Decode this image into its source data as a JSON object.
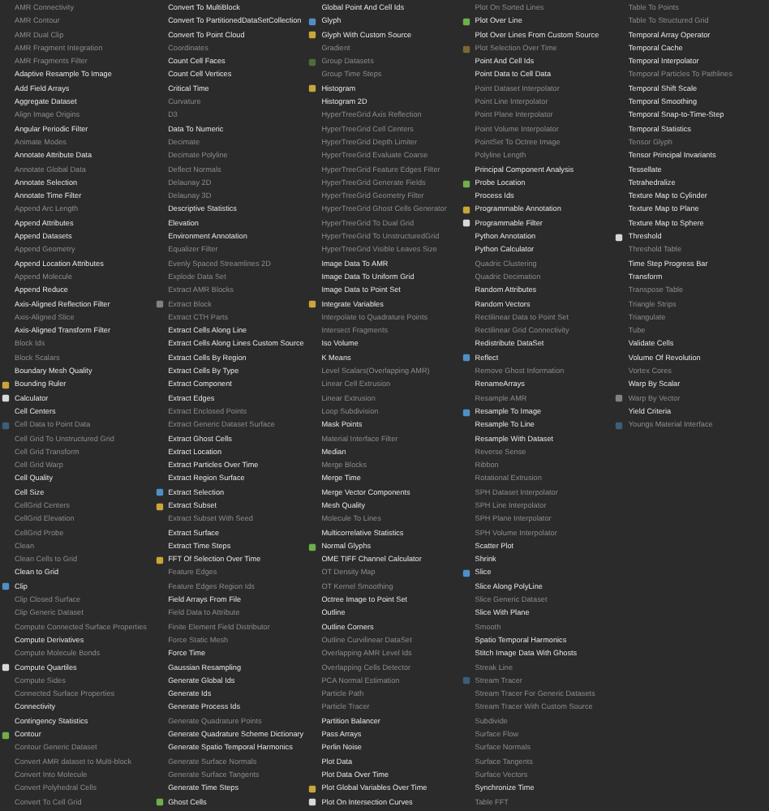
{
  "menu": {
    "columns": [
      {
        "items": [
          {
            "label": "AMR Connectivity",
            "disabled": true,
            "kind": "plain"
          },
          {
            "label": "AMR Contour",
            "disabled": true,
            "kind": "plain"
          },
          {
            "label": "AMR Dual Clip",
            "disabled": true,
            "kind": "plain"
          },
          {
            "label": "AMR Fragment Integration",
            "disabled": true,
            "kind": "plain"
          },
          {
            "label": "AMR Fragments Filter",
            "disabled": true,
            "kind": "plain"
          },
          {
            "label": "Adaptive Resample To Image",
            "disabled": false,
            "kind": "plain"
          },
          {
            "label": "Add Field Arrays",
            "disabled": false,
            "kind": "plain"
          },
          {
            "label": "Aggregate Dataset",
            "disabled": false,
            "kind": "plain"
          },
          {
            "label": "Align Image Origins",
            "disabled": true,
            "kind": "plain"
          },
          {
            "label": "Angular Periodic Filter",
            "disabled": false,
            "kind": "plain"
          },
          {
            "label": "Animate Modes",
            "disabled": true,
            "kind": "plain"
          },
          {
            "label": "Annotate Attribute Data",
            "disabled": false,
            "kind": "plain"
          },
          {
            "label": "Annotate Global Data",
            "disabled": true,
            "kind": "plain"
          },
          {
            "label": "Annotate Selection",
            "disabled": false,
            "kind": "plain"
          },
          {
            "label": "Annotate Time Filter",
            "disabled": false,
            "kind": "plain"
          },
          {
            "label": "Append Arc Length",
            "disabled": true,
            "kind": "plain"
          },
          {
            "label": "Append Attributes",
            "disabled": false,
            "kind": "plain"
          },
          {
            "label": "Append Datasets",
            "disabled": false,
            "kind": "plain"
          },
          {
            "label": "Append Geometry",
            "disabled": true,
            "kind": "plain"
          },
          {
            "label": "Append Location Attributes",
            "disabled": false,
            "kind": "plain"
          },
          {
            "label": "Append Molecule",
            "disabled": true,
            "kind": "plain"
          },
          {
            "label": "Append Reduce",
            "disabled": false,
            "kind": "plain"
          },
          {
            "label": "Axis-Aligned Reflection Filter",
            "disabled": false,
            "kind": "plain"
          },
          {
            "label": "Axis-Aligned Slice",
            "disabled": true,
            "kind": "plain"
          },
          {
            "label": "Axis-Aligned Transform Filter",
            "disabled": false,
            "kind": "plain"
          },
          {
            "label": "Block Ids",
            "disabled": true,
            "kind": "plain"
          },
          {
            "label": "Block Scalars",
            "disabled": true,
            "kind": "plain"
          },
          {
            "label": "Boundary Mesh Quality",
            "disabled": false,
            "kind": "plain"
          },
          {
            "label": "Bounding Ruler",
            "disabled": false,
            "kind": "icon"
          },
          {
            "label": "Calculator",
            "disabled": false,
            "kind": "icon"
          },
          {
            "label": "Cell Centers",
            "disabled": false,
            "kind": "plain"
          },
          {
            "label": "Cell Data to Point Data",
            "disabled": true,
            "kind": "icon"
          },
          {
            "label": "Cell Grid To Unstructured Grid",
            "disabled": true,
            "kind": "plain"
          },
          {
            "label": "Cell Grid Transform",
            "disabled": true,
            "kind": "plain"
          },
          {
            "label": "Cell Grid Warp",
            "disabled": true,
            "kind": "plain"
          },
          {
            "label": "Cell Quality",
            "disabled": false,
            "kind": "plain"
          },
          {
            "label": "Cell Size",
            "disabled": false,
            "kind": "plain"
          },
          {
            "label": "CellGrid Centers",
            "disabled": true,
            "kind": "plain"
          },
          {
            "label": "CellGrid Elevation",
            "disabled": true,
            "kind": "plain"
          },
          {
            "label": "CellGrid Probe",
            "disabled": true,
            "kind": "plain"
          },
          {
            "label": "Clean",
            "disabled": true,
            "kind": "plain"
          },
          {
            "label": "Clean Cells to Grid",
            "disabled": true,
            "kind": "plain"
          },
          {
            "label": "Clean to Grid",
            "disabled": false,
            "kind": "plain"
          },
          {
            "label": "Clip",
            "disabled": false,
            "kind": "icon"
          },
          {
            "label": "Clip Closed Surface",
            "disabled": true,
            "kind": "plain"
          },
          {
            "label": "Clip Generic Dataset",
            "disabled": true,
            "kind": "plain"
          },
          {
            "label": "Compute Connected Surface Properties",
            "disabled": true,
            "kind": "plain"
          },
          {
            "label": "Compute Derivatives",
            "disabled": false,
            "kind": "plain"
          },
          {
            "label": "Compute Molecule Bonds",
            "disabled": true,
            "kind": "plain"
          },
          {
            "label": "Compute Quartiles",
            "disabled": false,
            "kind": "icon"
          },
          {
            "label": "Compute Sides",
            "disabled": true,
            "kind": "plain"
          },
          {
            "label": "Connected Surface Properties",
            "disabled": true,
            "kind": "plain"
          },
          {
            "label": "Connectivity",
            "disabled": false,
            "kind": "plain"
          },
          {
            "label": "Contingency Statistics",
            "disabled": false,
            "kind": "plain"
          },
          {
            "label": "Contour",
            "disabled": false,
            "kind": "icon"
          },
          {
            "label": "Contour Generic Dataset",
            "disabled": true,
            "kind": "plain"
          },
          {
            "label": "Convert AMR dataset to Multi-block",
            "disabled": true,
            "kind": "plain"
          },
          {
            "label": "Convert Into Molecule",
            "disabled": true,
            "kind": "plain"
          },
          {
            "label": "Convert Polyhedral Cells",
            "disabled": true,
            "kind": "plain"
          },
          {
            "label": "Convert To Cell Grid",
            "disabled": true,
            "kind": "plain"
          }
        ]
      },
      {
        "items": [
          {
            "label": "Convert To MultiBlock",
            "disabled": false,
            "kind": "plain"
          },
          {
            "label": "Convert To PartitionedDataSetCollection",
            "disabled": false,
            "kind": "plain"
          },
          {
            "label": "Convert To Point Cloud",
            "disabled": false,
            "kind": "plain"
          },
          {
            "label": "Coordinates",
            "disabled": true,
            "kind": "plain"
          },
          {
            "label": "Count Cell Faces",
            "disabled": false,
            "kind": "plain"
          },
          {
            "label": "Count Cell Vertices",
            "disabled": false,
            "kind": "plain"
          },
          {
            "label": "Critical Time",
            "disabled": false,
            "kind": "plain"
          },
          {
            "label": "Curvature",
            "disabled": true,
            "kind": "plain"
          },
          {
            "label": "D3",
            "disabled": true,
            "kind": "plain"
          },
          {
            "label": "Data To Numeric",
            "disabled": false,
            "kind": "plain"
          },
          {
            "label": "Decimate",
            "disabled": true,
            "kind": "plain"
          },
          {
            "label": "Decimate Polyline",
            "disabled": true,
            "kind": "plain"
          },
          {
            "label": "Deflect Normals",
            "disabled": true,
            "kind": "plain"
          },
          {
            "label": "Delaunay 2D",
            "disabled": true,
            "kind": "plain"
          },
          {
            "label": "Delaunay 3D",
            "disabled": true,
            "kind": "plain"
          },
          {
            "label": "Descriptive Statistics",
            "disabled": false,
            "kind": "plain"
          },
          {
            "label": "Elevation",
            "disabled": false,
            "kind": "plain"
          },
          {
            "label": "Environment Annotation",
            "disabled": false,
            "kind": "plain"
          },
          {
            "label": "Equalizer Filter",
            "disabled": true,
            "kind": "plain"
          },
          {
            "label": "Evenly Spaced Streamlines 2D",
            "disabled": true,
            "kind": "plain"
          },
          {
            "label": "Explode Data Set",
            "disabled": true,
            "kind": "plain"
          },
          {
            "label": "Extract AMR Blocks",
            "disabled": true,
            "kind": "plain"
          },
          {
            "label": "Extract Block",
            "disabled": true,
            "kind": "icon"
          },
          {
            "label": "Extract CTH Parts",
            "disabled": true,
            "kind": "plain"
          },
          {
            "label": "Extract Cells Along Line",
            "disabled": false,
            "kind": "plain"
          },
          {
            "label": "Extract Cells Along Lines Custom Source",
            "disabled": false,
            "kind": "plain"
          },
          {
            "label": "Extract Cells By Region",
            "disabled": false,
            "kind": "plain"
          },
          {
            "label": "Extract Cells By Type",
            "disabled": false,
            "kind": "plain"
          },
          {
            "label": "Extract Component",
            "disabled": false,
            "kind": "plain"
          },
          {
            "label": "Extract Edges",
            "disabled": false,
            "kind": "plain"
          },
          {
            "label": "Extract Enclosed Points",
            "disabled": true,
            "kind": "plain"
          },
          {
            "label": "Extract Generic Dataset Surface",
            "disabled": true,
            "kind": "plain"
          },
          {
            "label": "Extract Ghost Cells",
            "disabled": false,
            "kind": "plain"
          },
          {
            "label": "Extract Location",
            "disabled": false,
            "kind": "plain"
          },
          {
            "label": "Extract Particles Over Time",
            "disabled": false,
            "kind": "plain"
          },
          {
            "label": "Extract Region Surface",
            "disabled": false,
            "kind": "plain"
          },
          {
            "label": "Extract Selection",
            "disabled": false,
            "kind": "icon"
          },
          {
            "label": "Extract Subset",
            "disabled": false,
            "kind": "icon"
          },
          {
            "label": "Extract Subset With Seed",
            "disabled": true,
            "kind": "plain"
          },
          {
            "label": "Extract Surface",
            "disabled": false,
            "kind": "plain"
          },
          {
            "label": "Extract Time Steps",
            "disabled": false,
            "kind": "plain"
          },
          {
            "label": "FFT Of Selection Over Time",
            "disabled": false,
            "kind": "icon"
          },
          {
            "label": "Feature Edges",
            "disabled": true,
            "kind": "plain"
          },
          {
            "label": "Feature Edges Region Ids",
            "disabled": true,
            "kind": "plain"
          },
          {
            "label": "Field Arrays From File",
            "disabled": false,
            "kind": "plain"
          },
          {
            "label": "Field Data to Attribute",
            "disabled": true,
            "kind": "plain"
          },
          {
            "label": "Finite Element Field Distributor",
            "disabled": true,
            "kind": "plain"
          },
          {
            "label": "Force Static Mesh",
            "disabled": true,
            "kind": "plain"
          },
          {
            "label": "Force Time",
            "disabled": false,
            "kind": "plain"
          },
          {
            "label": "Gaussian Resampling",
            "disabled": false,
            "kind": "plain"
          },
          {
            "label": "Generate Global Ids",
            "disabled": false,
            "kind": "plain"
          },
          {
            "label": "Generate Ids",
            "disabled": false,
            "kind": "plain"
          },
          {
            "label": "Generate Process Ids",
            "disabled": false,
            "kind": "plain"
          },
          {
            "label": "Generate Quadrature Points",
            "disabled": true,
            "kind": "plain"
          },
          {
            "label": "Generate Quadrature Scheme Dictionary",
            "disabled": false,
            "kind": "plain"
          },
          {
            "label": "Generate Spatio Temporal Harmonics",
            "disabled": false,
            "kind": "plain"
          },
          {
            "label": "Generate Surface Normals",
            "disabled": true,
            "kind": "plain"
          },
          {
            "label": "Generate Surface Tangents",
            "disabled": true,
            "kind": "plain"
          },
          {
            "label": "Generate Time Steps",
            "disabled": false,
            "kind": "plain"
          },
          {
            "label": "Ghost Cells",
            "disabled": false,
            "kind": "icon"
          }
        ]
      },
      {
        "items": [
          {
            "label": "Global Point And Cell Ids",
            "disabled": false,
            "kind": "plain"
          },
          {
            "label": "Glyph",
            "disabled": false,
            "kind": "icon"
          },
          {
            "label": "Glyph With Custom Source",
            "disabled": false,
            "kind": "icon"
          },
          {
            "label": "Gradient",
            "disabled": true,
            "kind": "plain"
          },
          {
            "label": "Group Datasets",
            "disabled": true,
            "kind": "icon"
          },
          {
            "label": "Group Time Steps",
            "disabled": true,
            "kind": "plain"
          },
          {
            "label": "Histogram",
            "disabled": false,
            "kind": "icon"
          },
          {
            "label": "Histogram 2D",
            "disabled": false,
            "kind": "plain"
          },
          {
            "label": "HyperTreeGrid Axis Reflection",
            "disabled": true,
            "kind": "plain"
          },
          {
            "label": "HyperTreeGrid Cell Centers",
            "disabled": true,
            "kind": "plain"
          },
          {
            "label": "HyperTreeGrid Depth Limiter",
            "disabled": true,
            "kind": "plain"
          },
          {
            "label": "HyperTreeGrid Evaluate Coarse",
            "disabled": true,
            "kind": "plain"
          },
          {
            "label": "HyperTreeGrid Feature Edges Filter",
            "disabled": true,
            "kind": "plain"
          },
          {
            "label": "HyperTreeGrid Generate Fields",
            "disabled": true,
            "kind": "plain"
          },
          {
            "label": "HyperTreeGrid Geometry Filter",
            "disabled": true,
            "kind": "plain"
          },
          {
            "label": "HyperTreeGrid Ghost Cells Generator",
            "disabled": true,
            "kind": "plain"
          },
          {
            "label": "HyperTreeGrid To Dual Grid",
            "disabled": true,
            "kind": "plain"
          },
          {
            "label": "HyperTreeGrid To UnstructuredGrid",
            "disabled": true,
            "kind": "plain"
          },
          {
            "label": "HyperTreeGrid Visible Leaves Size",
            "disabled": true,
            "kind": "plain"
          },
          {
            "label": "Image Data To AMR",
            "disabled": false,
            "kind": "plain"
          },
          {
            "label": "Image Data To Uniform Grid",
            "disabled": false,
            "kind": "plain"
          },
          {
            "label": "Image Data to Point Set",
            "disabled": false,
            "kind": "plain"
          },
          {
            "label": "Integrate Variables",
            "disabled": false,
            "kind": "icon"
          },
          {
            "label": "Interpolate to Quadrature Points",
            "disabled": true,
            "kind": "plain"
          },
          {
            "label": "Intersect Fragments",
            "disabled": true,
            "kind": "plain"
          },
          {
            "label": "Iso Volume",
            "disabled": false,
            "kind": "plain"
          },
          {
            "label": "K Means",
            "disabled": false,
            "kind": "plain"
          },
          {
            "label": "Level Scalars(Overlapping AMR)",
            "disabled": true,
            "kind": "plain"
          },
          {
            "label": "Linear Cell Extrusion",
            "disabled": true,
            "kind": "plain"
          },
          {
            "label": "Linear Extrusion",
            "disabled": true,
            "kind": "plain"
          },
          {
            "label": "Loop Subdivision",
            "disabled": true,
            "kind": "plain"
          },
          {
            "label": "Mask Points",
            "disabled": false,
            "kind": "plain"
          },
          {
            "label": "Material Interface Filter",
            "disabled": true,
            "kind": "plain"
          },
          {
            "label": "Median",
            "disabled": false,
            "kind": "plain"
          },
          {
            "label": "Merge Blocks",
            "disabled": true,
            "kind": "plain"
          },
          {
            "label": "Merge Time",
            "disabled": false,
            "kind": "plain"
          },
          {
            "label": "Merge Vector Components",
            "disabled": false,
            "kind": "plain"
          },
          {
            "label": "Mesh Quality",
            "disabled": false,
            "kind": "plain"
          },
          {
            "label": "Molecule To Lines",
            "disabled": true,
            "kind": "plain"
          },
          {
            "label": "Multicorrelative Statistics",
            "disabled": false,
            "kind": "plain"
          },
          {
            "label": "Normal Glyphs",
            "disabled": false,
            "kind": "icon"
          },
          {
            "label": "OME TIFF Channel Calculator",
            "disabled": false,
            "kind": "plain"
          },
          {
            "label": "OT Density Map",
            "disabled": true,
            "kind": "plain"
          },
          {
            "label": "OT Kernel Smoothing",
            "disabled": true,
            "kind": "plain"
          },
          {
            "label": "Octree Image to Point Set",
            "disabled": false,
            "kind": "plain"
          },
          {
            "label": "Outline",
            "disabled": false,
            "kind": "plain"
          },
          {
            "label": "Outline Corners",
            "disabled": false,
            "kind": "plain"
          },
          {
            "label": "Outline Curvilinear DataSet",
            "disabled": true,
            "kind": "plain"
          },
          {
            "label": "Overlapping AMR Level Ids",
            "disabled": true,
            "kind": "plain"
          },
          {
            "label": "Overlapping Cells Detector",
            "disabled": true,
            "kind": "plain"
          },
          {
            "label": "PCA Normal Estimation",
            "disabled": true,
            "kind": "plain"
          },
          {
            "label": "Particle Path",
            "disabled": true,
            "kind": "plain"
          },
          {
            "label": "Particle Tracer",
            "disabled": true,
            "kind": "plain"
          },
          {
            "label": "Partition Balancer",
            "disabled": false,
            "kind": "plain"
          },
          {
            "label": "Pass Arrays",
            "disabled": false,
            "kind": "plain"
          },
          {
            "label": "Perlin Noise",
            "disabled": false,
            "kind": "plain"
          },
          {
            "label": "Plot Data",
            "disabled": false,
            "kind": "plain"
          },
          {
            "label": "Plot Data Over Time",
            "disabled": false,
            "kind": "plain"
          },
          {
            "label": "Plot Global Variables Over Time",
            "disabled": false,
            "kind": "icon"
          },
          {
            "label": "Plot On Intersection Curves",
            "disabled": false,
            "kind": "icon"
          }
        ]
      },
      {
        "items": [
          {
            "label": "Plot On Sorted Lines",
            "disabled": true,
            "kind": "plain"
          },
          {
            "label": "Plot Over Line",
            "disabled": false,
            "kind": "icon"
          },
          {
            "label": "Plot Over Lines From Custom Source",
            "disabled": false,
            "kind": "plain"
          },
          {
            "label": "Plot Selection Over Time",
            "disabled": true,
            "kind": "icon"
          },
          {
            "label": "Point And Cell Ids",
            "disabled": false,
            "kind": "plain"
          },
          {
            "label": "Point Data to Cell Data",
            "disabled": false,
            "kind": "plain"
          },
          {
            "label": "Point Dataset Interpolator",
            "disabled": true,
            "kind": "plain"
          },
          {
            "label": "Point Line Interpolator",
            "disabled": true,
            "kind": "plain"
          },
          {
            "label": "Point Plane Interpolator",
            "disabled": true,
            "kind": "plain"
          },
          {
            "label": "Point Volume Interpolator",
            "disabled": true,
            "kind": "plain"
          },
          {
            "label": "PointSet To Octree Image",
            "disabled": true,
            "kind": "plain"
          },
          {
            "label": "Polyline Length",
            "disabled": true,
            "kind": "plain"
          },
          {
            "label": "Principal Component Analysis",
            "disabled": false,
            "kind": "plain"
          },
          {
            "label": "Probe Location",
            "disabled": false,
            "kind": "icon"
          },
          {
            "label": "Process Ids",
            "disabled": false,
            "kind": "plain"
          },
          {
            "label": "Programmable Annotation",
            "disabled": false,
            "kind": "icon"
          },
          {
            "label": "Programmable Filter",
            "disabled": false,
            "kind": "icon"
          },
          {
            "label": "Python Annotation",
            "disabled": false,
            "kind": "plain"
          },
          {
            "label": "Python Calculator",
            "disabled": false,
            "kind": "plain"
          },
          {
            "label": "Quadric Clustering",
            "disabled": true,
            "kind": "plain"
          },
          {
            "label": "Quadric Decimation",
            "disabled": true,
            "kind": "plain"
          },
          {
            "label": "Random Attributes",
            "disabled": false,
            "kind": "plain"
          },
          {
            "label": "Random Vectors",
            "disabled": false,
            "kind": "plain"
          },
          {
            "label": "Rectilinear Data to Point Set",
            "disabled": true,
            "kind": "plain"
          },
          {
            "label": "Rectilinear Grid Connectivity",
            "disabled": true,
            "kind": "plain"
          },
          {
            "label": "Redistribute DataSet",
            "disabled": false,
            "kind": "plain"
          },
          {
            "label": "Reflect",
            "disabled": false,
            "kind": "icon"
          },
          {
            "label": "Remove Ghost Information",
            "disabled": true,
            "kind": "plain"
          },
          {
            "label": "RenameArrays",
            "disabled": false,
            "kind": "plain"
          },
          {
            "label": "Resample AMR",
            "disabled": true,
            "kind": "plain"
          },
          {
            "label": "Resample To Image",
            "disabled": false,
            "kind": "icon"
          },
          {
            "label": "Resample To Line",
            "disabled": false,
            "kind": "plain"
          },
          {
            "label": "Resample With Dataset",
            "disabled": false,
            "kind": "plain"
          },
          {
            "label": "Reverse Sense",
            "disabled": true,
            "kind": "plain"
          },
          {
            "label": "Ribbon",
            "disabled": true,
            "kind": "plain"
          },
          {
            "label": "Rotational Extrusion",
            "disabled": true,
            "kind": "plain"
          },
          {
            "label": "SPH Dataset Interpolator",
            "disabled": true,
            "kind": "plain"
          },
          {
            "label": "SPH Line Interpolator",
            "disabled": true,
            "kind": "plain"
          },
          {
            "label": "SPH Plane Interpolator",
            "disabled": true,
            "kind": "plain"
          },
          {
            "label": "SPH Volume Interpolator",
            "disabled": true,
            "kind": "plain"
          },
          {
            "label": "Scatter Plot",
            "disabled": false,
            "kind": "plain"
          },
          {
            "label": "Shrink",
            "disabled": false,
            "kind": "plain"
          },
          {
            "label": "Slice",
            "disabled": false,
            "kind": "icon"
          },
          {
            "label": "Slice Along PolyLine",
            "disabled": false,
            "kind": "plain"
          },
          {
            "label": "Slice Generic Dataset",
            "disabled": true,
            "kind": "plain"
          },
          {
            "label": "Slice With Plane",
            "disabled": false,
            "kind": "plain"
          },
          {
            "label": "Smooth",
            "disabled": true,
            "kind": "plain"
          },
          {
            "label": "Spatio Temporal Harmonics",
            "disabled": false,
            "kind": "plain"
          },
          {
            "label": "Stitch Image Data With Ghosts",
            "disabled": false,
            "kind": "plain"
          },
          {
            "label": "Streak Line",
            "disabled": true,
            "kind": "plain"
          },
          {
            "label": "Stream Tracer",
            "disabled": true,
            "kind": "icon"
          },
          {
            "label": "Stream Tracer For Generic Datasets",
            "disabled": true,
            "kind": "plain"
          },
          {
            "label": "Stream Tracer With Custom Source",
            "disabled": true,
            "kind": "plain"
          },
          {
            "label": "Subdivide",
            "disabled": true,
            "kind": "plain"
          },
          {
            "label": "Surface Flow",
            "disabled": true,
            "kind": "plain"
          },
          {
            "label": "Surface Normals",
            "disabled": true,
            "kind": "plain"
          },
          {
            "label": "Surface Tangents",
            "disabled": true,
            "kind": "plain"
          },
          {
            "label": "Surface Vectors",
            "disabled": true,
            "kind": "plain"
          },
          {
            "label": "Synchronize Time",
            "disabled": false,
            "kind": "plain"
          },
          {
            "label": "Table FFT",
            "disabled": true,
            "kind": "plain"
          }
        ]
      },
      {
        "items": [
          {
            "label": "Table To Points",
            "disabled": true,
            "kind": "plain"
          },
          {
            "label": "Table To Structured Grid",
            "disabled": true,
            "kind": "plain"
          },
          {
            "label": "Temporal Array Operator",
            "disabled": false,
            "kind": "plain"
          },
          {
            "label": "Temporal Cache",
            "disabled": false,
            "kind": "plain"
          },
          {
            "label": "Temporal Interpolator",
            "disabled": false,
            "kind": "plain"
          },
          {
            "label": "Temporal Particles To Pathlines",
            "disabled": true,
            "kind": "plain"
          },
          {
            "label": "Temporal Shift Scale",
            "disabled": false,
            "kind": "plain"
          },
          {
            "label": "Temporal Smoothing",
            "disabled": false,
            "kind": "plain"
          },
          {
            "label": "Temporal Snap-to-Time-Step",
            "disabled": false,
            "kind": "plain"
          },
          {
            "label": "Temporal Statistics",
            "disabled": false,
            "kind": "plain"
          },
          {
            "label": "Tensor Glyph",
            "disabled": true,
            "kind": "plain"
          },
          {
            "label": "Tensor Principal Invariants",
            "disabled": false,
            "kind": "plain"
          },
          {
            "label": "Tessellate",
            "disabled": false,
            "kind": "plain"
          },
          {
            "label": "Tetrahedralize",
            "disabled": false,
            "kind": "plain"
          },
          {
            "label": "Texture Map to Cylinder",
            "disabled": false,
            "kind": "plain"
          },
          {
            "label": "Texture Map to Plane",
            "disabled": false,
            "kind": "plain"
          },
          {
            "label": "Texture Map to Sphere",
            "disabled": false,
            "kind": "plain"
          },
          {
            "label": "Threshold",
            "disabled": false,
            "kind": "icon"
          },
          {
            "label": "Threshold Table",
            "disabled": true,
            "kind": "plain"
          },
          {
            "label": "Time Step Progress Bar",
            "disabled": false,
            "kind": "plain"
          },
          {
            "label": "Transform",
            "disabled": false,
            "kind": "plain"
          },
          {
            "label": "Transpose Table",
            "disabled": true,
            "kind": "plain"
          },
          {
            "label": "Triangle Strips",
            "disabled": true,
            "kind": "plain"
          },
          {
            "label": "Triangulate",
            "disabled": true,
            "kind": "plain"
          },
          {
            "label": "Tube",
            "disabled": true,
            "kind": "plain"
          },
          {
            "label": "Validate Cells",
            "disabled": false,
            "kind": "plain"
          },
          {
            "label": "Volume Of Revolution",
            "disabled": false,
            "kind": "plain"
          },
          {
            "label": "Vortex Cores",
            "disabled": true,
            "kind": "plain"
          },
          {
            "label": "Warp By Scalar",
            "disabled": false,
            "kind": "plain"
          },
          {
            "label": "Warp By Vector",
            "disabled": true,
            "kind": "icon"
          },
          {
            "label": "Yield Criteria",
            "disabled": false,
            "kind": "plain"
          },
          {
            "label": "Youngs Material Interface",
            "disabled": true,
            "kind": "icon"
          }
        ]
      }
    ]
  }
}
